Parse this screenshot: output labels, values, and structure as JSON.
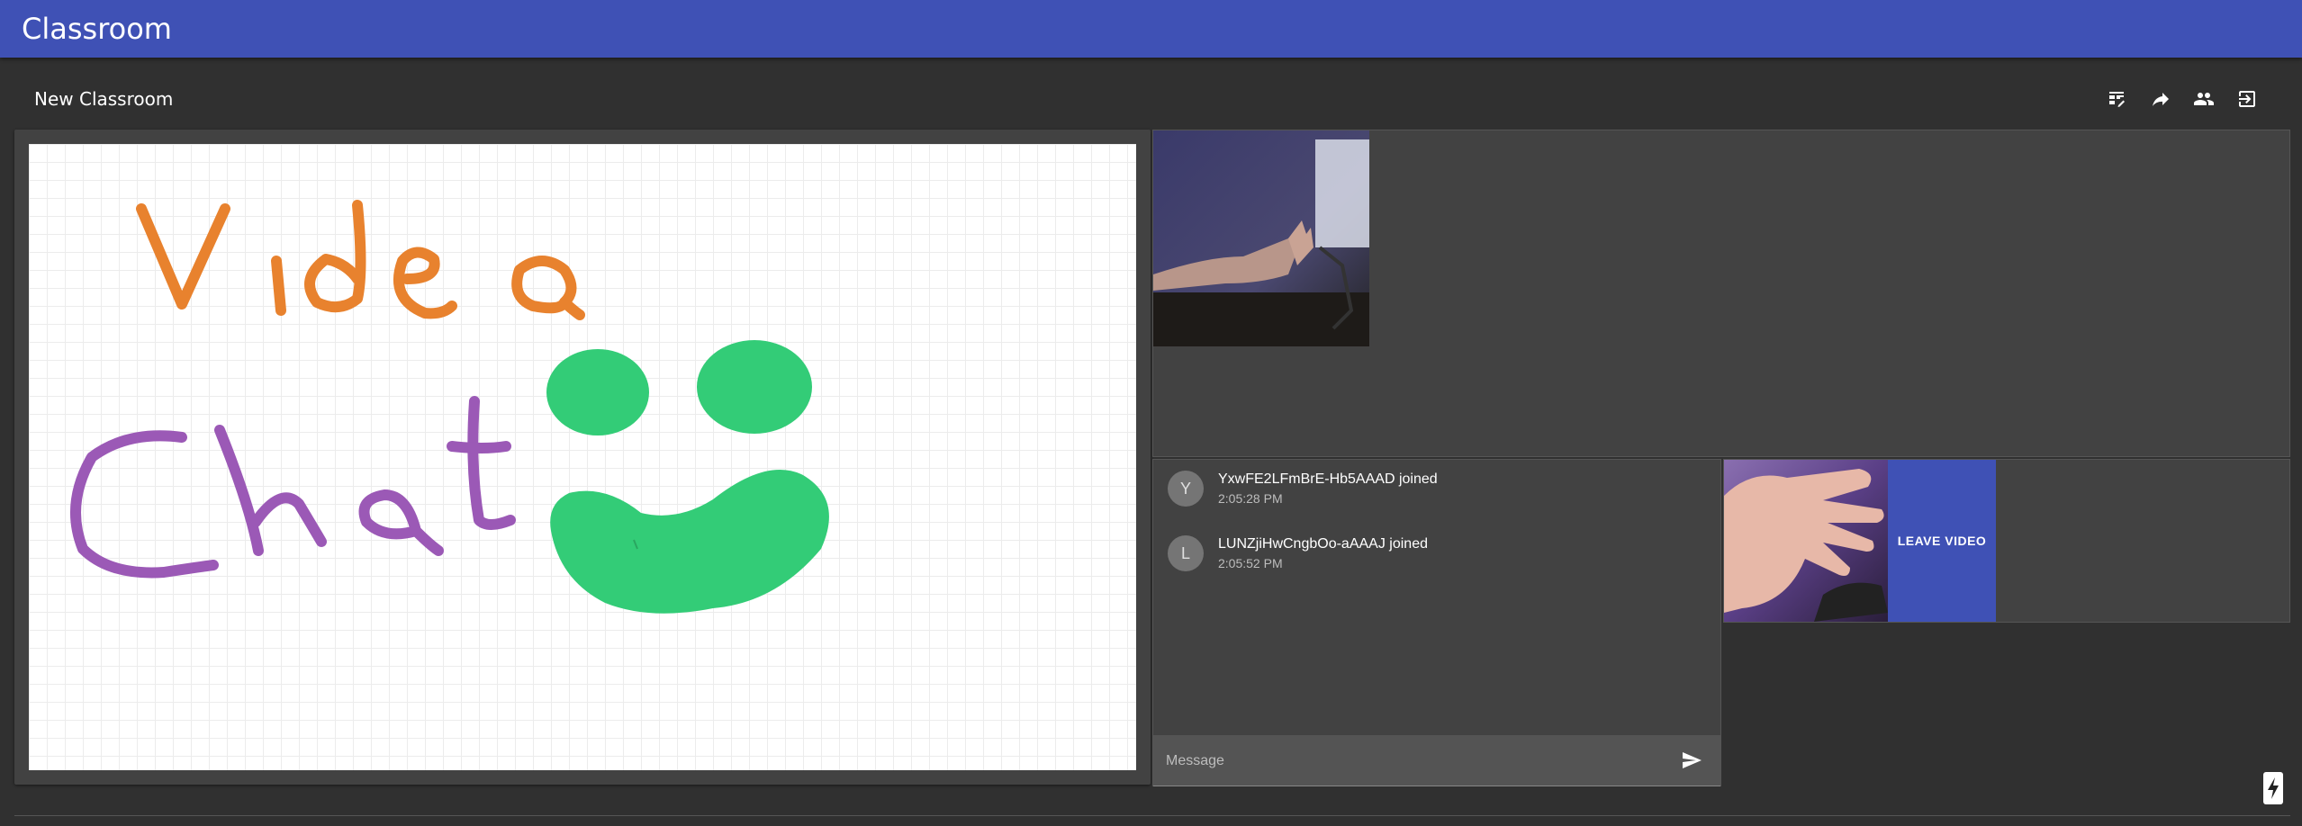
{
  "app": {
    "title": "Classroom"
  },
  "classroom": {
    "name": "New Classroom"
  },
  "toolbar": {
    "icons": [
      "table-edit-icon",
      "share-icon",
      "people-icon",
      "exit-icon"
    ]
  },
  "whiteboard": {
    "stroke_colors": {
      "orange": "#e8822e",
      "purple": "#9b59b6",
      "green": "#33cc77"
    }
  },
  "chat": {
    "messages": [
      {
        "avatar": "Y",
        "text": "YxwFE2LFmBrE-Hb5AAAD joined",
        "time": "2:05:28 PM"
      },
      {
        "avatar": "L",
        "text": "LUNZjiHwCngbOo-aAAAJ joined",
        "time": "2:05:52 PM"
      }
    ],
    "input_placeholder": "Message",
    "send_icon": "send-icon"
  },
  "video": {
    "leave_label": "LEAVE VIDEO"
  },
  "colors": {
    "appbar": "#3f51b5",
    "background": "#303030",
    "panel": "#424242",
    "accent": "#3f51b5"
  }
}
